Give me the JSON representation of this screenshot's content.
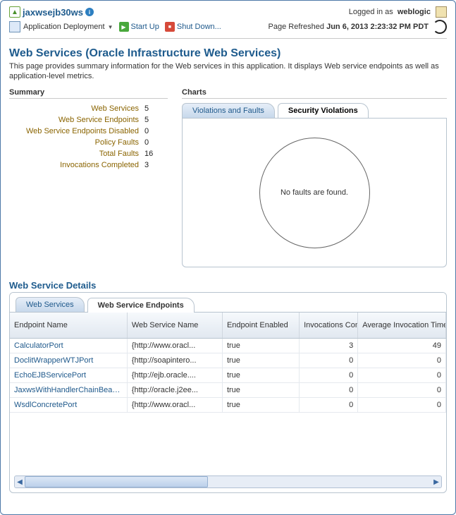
{
  "header": {
    "app_name": "jaxwsejb30ws",
    "logged_in_prefix": "Logged in as",
    "logged_in_user": "weblogic",
    "deploy_menu": "Application Deployment",
    "start_up": "Start Up",
    "shut_down": "Shut Down...",
    "page_refreshed_prefix": "Page Refreshed",
    "page_refreshed_time": "Jun 6, 2013 2:23:32 PM PDT"
  },
  "page": {
    "title": "Web Services (Oracle Infrastructure Web Services)",
    "description": "This page provides summary information for the Web services in this application. It displays Web service endpoints as well as application-level metrics."
  },
  "summary": {
    "heading": "Summary",
    "rows": [
      {
        "label": "Web Services",
        "value": "5"
      },
      {
        "label": "Web Service Endpoints",
        "value": "5"
      },
      {
        "label": "Web Service Endpoints Disabled",
        "value": "0"
      },
      {
        "label": "Policy Faults",
        "value": "0"
      },
      {
        "label": "Total Faults",
        "value": "16"
      },
      {
        "label": "Invocations Completed",
        "value": "3"
      }
    ]
  },
  "charts": {
    "heading": "Charts",
    "tab_inactive": "Violations and Faults",
    "tab_active": "Security Violations",
    "empty_msg": "No faults are found."
  },
  "details": {
    "heading": "Web Service Details",
    "tab_inactive": "Web Services",
    "tab_active": "Web Service Endpoints",
    "columns": {
      "endpoint": "Endpoint Name",
      "wsname": "Web Service Name",
      "enabled": "Endpoint Enabled",
      "inv": "Invocations Completed",
      "avg": "Average Invocation Time (ms)"
    },
    "rows": [
      {
        "endpoint": "CalculatorPort",
        "wsname": "{http://www.oracl...",
        "enabled": "true",
        "inv": "3",
        "avg": "49"
      },
      {
        "endpoint": "DoclitWrapperWTJPort",
        "wsname": "{http://soapintero...",
        "enabled": "true",
        "inv": "0",
        "avg": "0"
      },
      {
        "endpoint": "EchoEJBServicePort",
        "wsname": "{http://ejb.oracle....",
        "enabled": "true",
        "inv": "0",
        "avg": "0"
      },
      {
        "endpoint": "JaxwsWithHandlerChainBean...",
        "wsname": "{http://oracle.j2ee...",
        "enabled": "true",
        "inv": "0",
        "avg": "0"
      },
      {
        "endpoint": "WsdlConcretePort",
        "wsname": "{http://www.oracl...",
        "enabled": "true",
        "inv": "0",
        "avg": "0"
      }
    ]
  }
}
